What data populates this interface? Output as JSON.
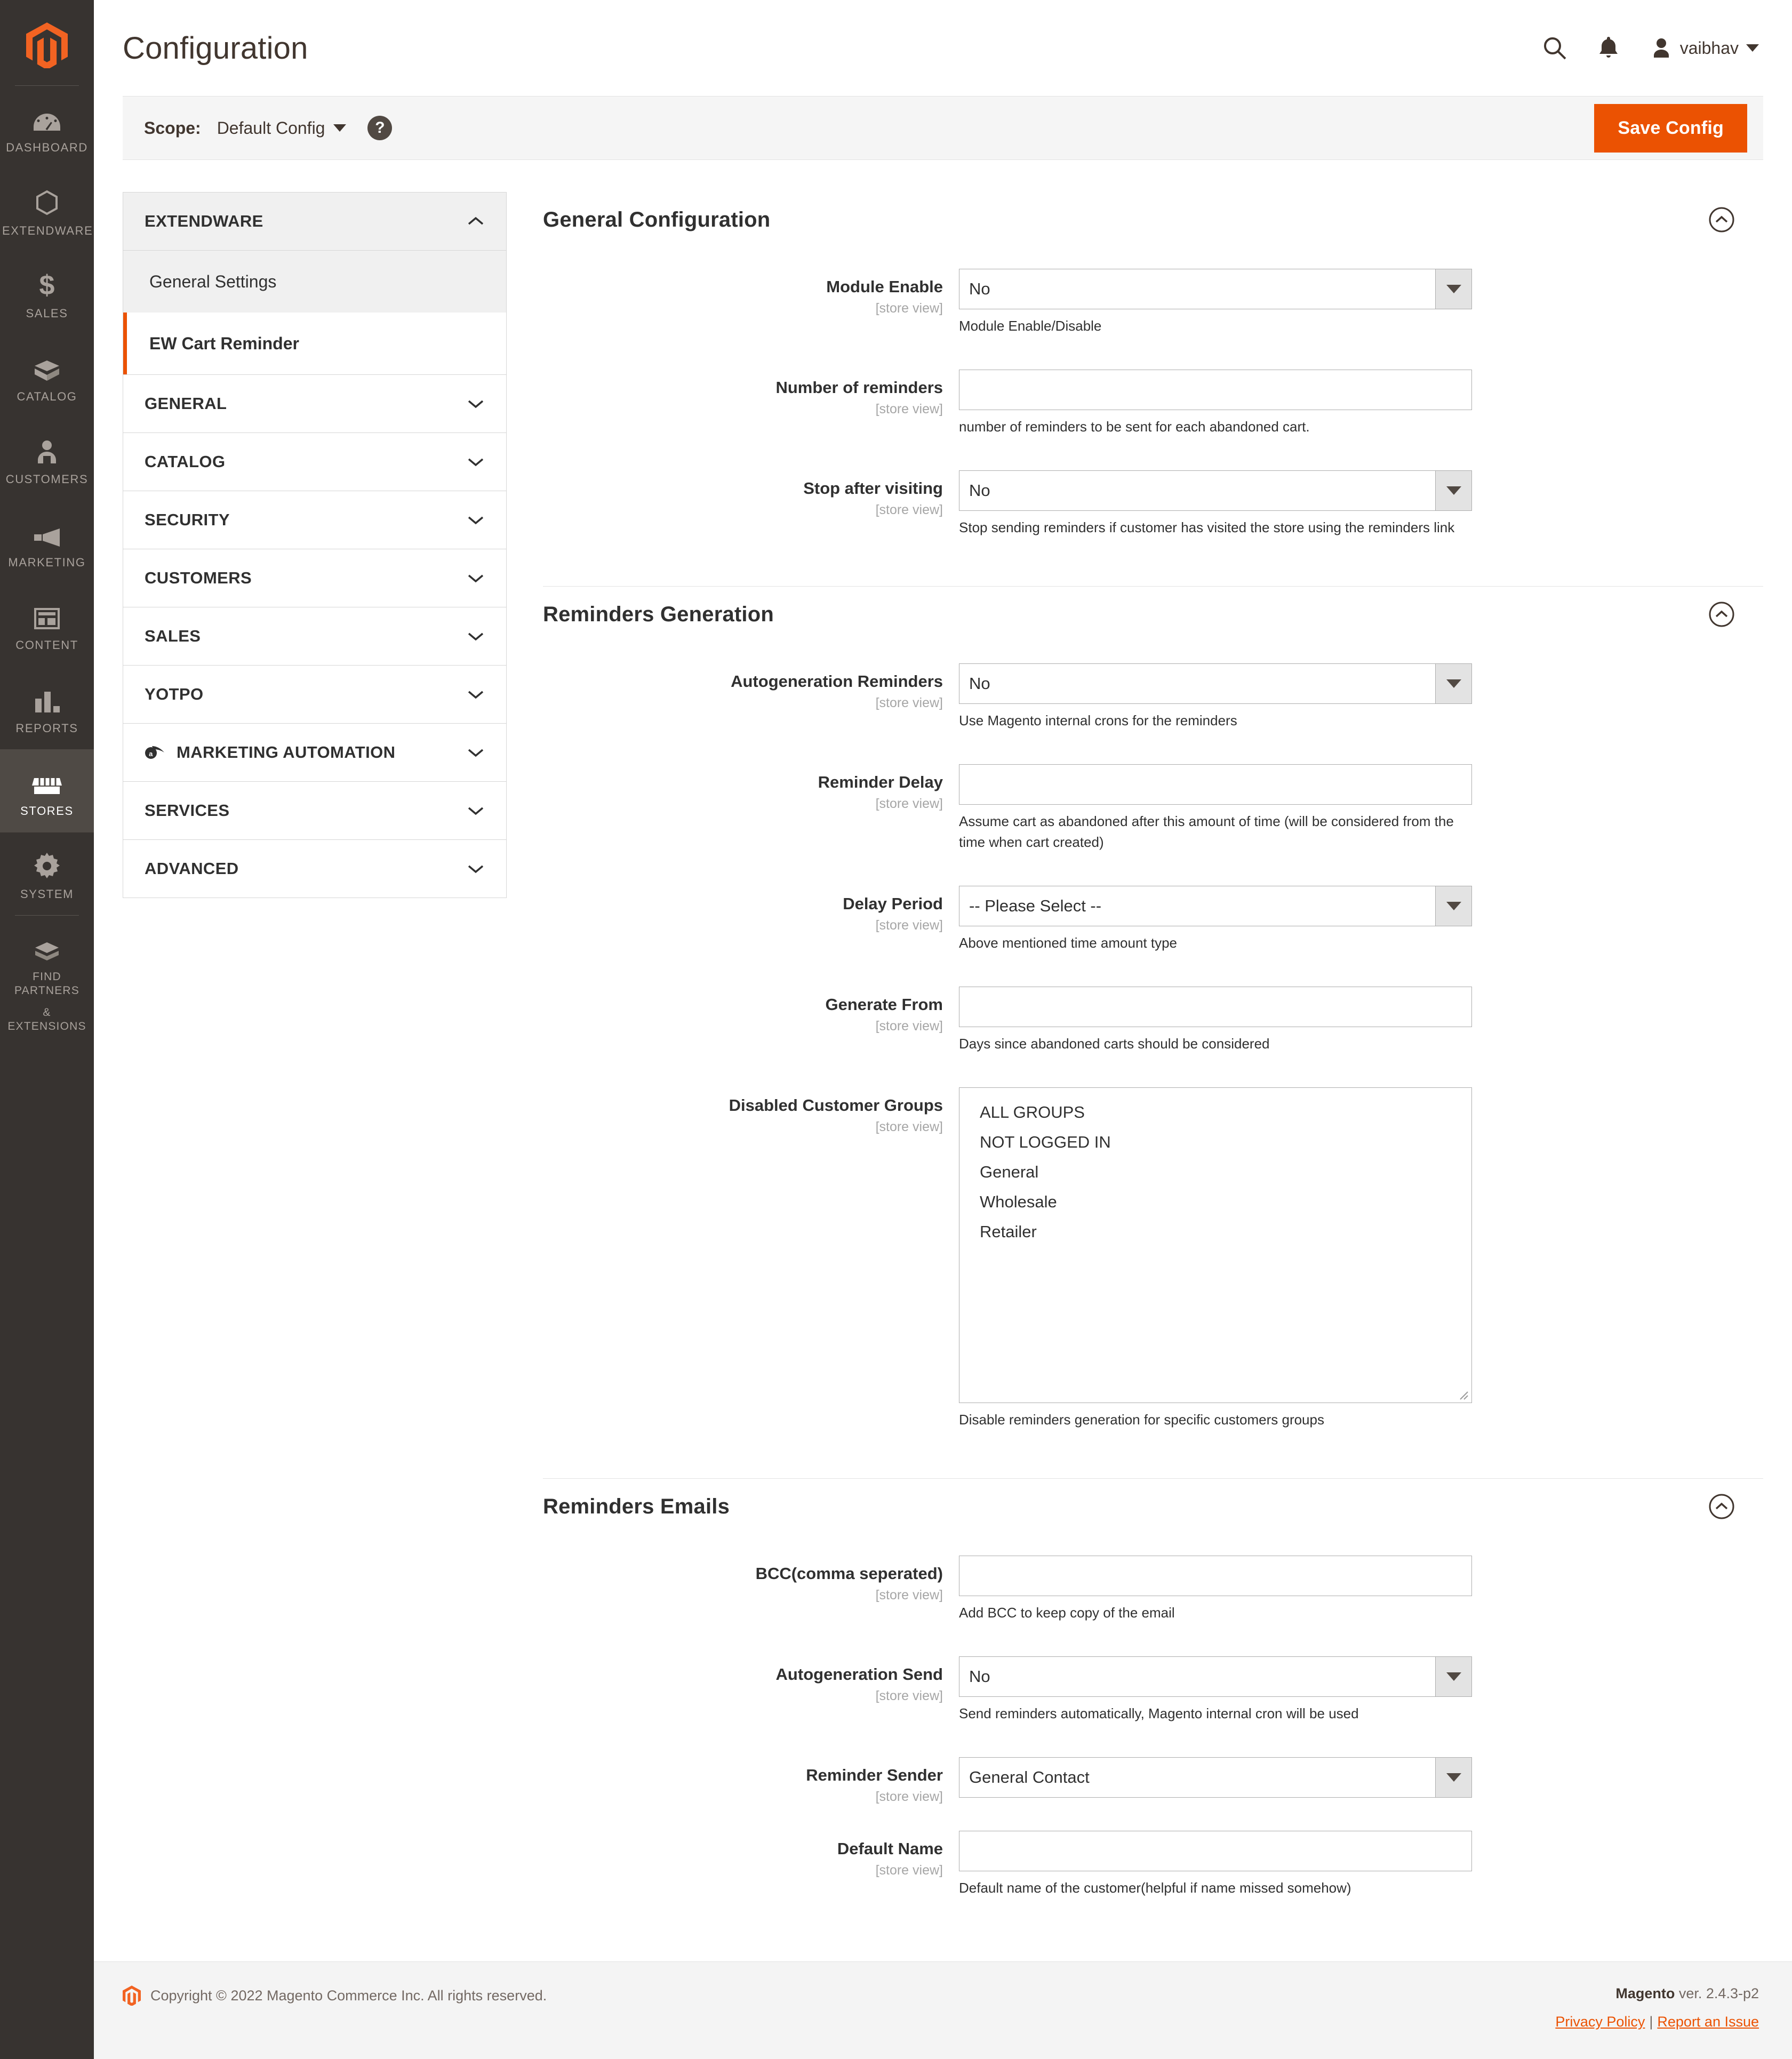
{
  "header": {
    "title": "Configuration",
    "search_icon": "search-icon",
    "notifications_icon": "bell-icon",
    "user_name": "vaibhav",
    "user_icon": "user-avatar-icon",
    "user_caret_icon": "chevron-down-icon"
  },
  "scopebar": {
    "label": "Scope:",
    "value": "Default Config",
    "caret_icon": "chevron-down-icon",
    "help_icon": "question-mark-icon",
    "help_glyph": "?",
    "save_label": "Save Config"
  },
  "adminnav": {
    "logo_icon": "magento-logo-icon",
    "items": [
      {
        "label": "DASHBOARD",
        "icon": "dashboard-gauge-icon",
        "active": false
      },
      {
        "label": "EXTENDWARE",
        "icon": "hexagon-icon",
        "active": false
      },
      {
        "label": "SALES",
        "icon": "dollar-sign-icon",
        "active": false
      },
      {
        "label": "CATALOG",
        "icon": "box-icon",
        "active": false
      },
      {
        "label": "CUSTOMERS",
        "icon": "customers-icon",
        "active": false
      },
      {
        "label": "MARKETING",
        "icon": "megaphone-icon",
        "active": false
      },
      {
        "label": "CONTENT",
        "icon": "layout-icon",
        "active": false
      },
      {
        "label": "REPORTS",
        "icon": "bar-chart-icon",
        "active": false
      },
      {
        "label": "STORES",
        "icon": "storefront-icon",
        "active": true
      },
      {
        "label": "SYSTEM",
        "icon": "gear-icon",
        "active": false
      },
      {
        "label": "FIND PARTNERS\n& EXTENSIONS",
        "label_line1": "FIND PARTNERS",
        "label_line2": "& EXTENSIONS",
        "icon": "partners-box-icon",
        "active": false
      }
    ]
  },
  "confignav": {
    "groups": [
      {
        "label": "EXTENDWARE",
        "open": true,
        "chevron_icon": "chevron-up-icon",
        "children": [
          {
            "label": "General Settings",
            "active": false
          },
          {
            "label": "EW Cart Reminder",
            "active": true
          }
        ]
      },
      {
        "label": "GENERAL",
        "open": false,
        "chevron_icon": "chevron-down-icon",
        "children": []
      },
      {
        "label": "CATALOG",
        "open": false,
        "chevron_icon": "chevron-down-icon",
        "children": []
      },
      {
        "label": "SECURITY",
        "open": false,
        "chevron_icon": "chevron-down-icon",
        "children": []
      },
      {
        "label": "CUSTOMERS",
        "open": false,
        "chevron_icon": "chevron-down-icon",
        "children": []
      },
      {
        "label": "SALES",
        "open": false,
        "chevron_icon": "chevron-down-icon",
        "children": []
      },
      {
        "label": "YOTPO",
        "open": false,
        "chevron_icon": "chevron-down-icon",
        "children": []
      },
      {
        "label": "MARKETING AUTOMATION",
        "open": false,
        "chevron_icon": "chevron-down-icon",
        "icon": "dotdigital-logo-icon",
        "children": []
      },
      {
        "label": "SERVICES",
        "open": false,
        "chevron_icon": "chevron-down-icon",
        "children": []
      },
      {
        "label": "ADVANCED",
        "open": false,
        "chevron_icon": "chevron-down-icon",
        "children": []
      }
    ]
  },
  "sections": {
    "general_configuration": {
      "title": "General Configuration",
      "collapse_icon": "chevron-up-circle-icon",
      "fields": {
        "module_enable": {
          "label": "Module Enable",
          "scope": "[store view]",
          "type": "select",
          "value": "No",
          "hint": "Module Enable/Disable"
        },
        "number_of_reminders": {
          "label": "Number of reminders",
          "scope": "[store view]",
          "type": "text",
          "value": "",
          "hint": "number of reminders to be sent for each abandoned cart."
        },
        "stop_after_visiting": {
          "label": "Stop after visiting",
          "scope": "[store view]",
          "type": "select",
          "value": "No",
          "hint": "Stop sending reminders if customer has visited the store using the reminders link"
        }
      }
    },
    "reminders_generation": {
      "title": "Reminders Generation",
      "collapse_icon": "chevron-up-circle-icon",
      "fields": {
        "autogeneration_reminders": {
          "label": "Autogeneration Reminders",
          "scope": "[store view]",
          "type": "select",
          "value": "No",
          "hint": "Use Magento internal crons for the reminders"
        },
        "reminder_delay": {
          "label": "Reminder Delay",
          "scope": "[store view]",
          "type": "text",
          "value": "",
          "hint": "Assume cart as abandoned after this amount of time (will be considered from the time when cart created)"
        },
        "delay_period": {
          "label": "Delay Period",
          "scope": "[store view]",
          "type": "select",
          "value": "-- Please Select --",
          "hint": "Above mentioned time amount type"
        },
        "generate_from": {
          "label": "Generate From",
          "scope": "[store view]",
          "type": "text",
          "value": "",
          "hint": "Days since abandoned carts should be considered"
        },
        "disabled_customer_groups": {
          "label": "Disabled Customer Groups",
          "scope": "[store view]",
          "type": "multiselect",
          "options": [
            "ALL GROUPS",
            "NOT LOGGED IN",
            "General",
            "Wholesale",
            "Retailer"
          ],
          "hint": "Disable reminders generation for specific customers groups"
        }
      }
    },
    "reminders_emails": {
      "title": "Reminders Emails",
      "collapse_icon": "chevron-up-circle-icon",
      "fields": {
        "bcc": {
          "label": "BCC(comma seperated)",
          "scope": "[store view]",
          "type": "text",
          "value": "",
          "hint": "Add BCC to keep copy of the email"
        },
        "autogeneration_send": {
          "label": "Autogeneration Send",
          "scope": "[store view]",
          "type": "select",
          "value": "No",
          "hint": "Send reminders automatically, Magento internal cron will be used"
        },
        "reminder_sender": {
          "label": "Reminder Sender",
          "scope": "[store view]",
          "type": "select",
          "value": "General Contact",
          "hint": ""
        },
        "default_name": {
          "label": "Default Name",
          "scope": "[store view]",
          "type": "text",
          "value": "",
          "hint": "Default name of the customer(helpful if name missed somehow)"
        }
      }
    }
  },
  "footer": {
    "logo_icon": "magento-logo-icon",
    "copyright": "Copyright © 2022 Magento Commerce Inc. All rights reserved.",
    "brand": "Magento",
    "version": " ver. 2.4.3-p2",
    "privacy_policy": "Privacy Policy",
    "separator": "|",
    "report_issue": "Report an Issue"
  },
  "colors": {
    "accent_orange": "#eb5202",
    "nav_dark": "#373330",
    "nav_active": "#4f4a45",
    "text_dark": "#303030",
    "muted": "#a6a6a6"
  }
}
